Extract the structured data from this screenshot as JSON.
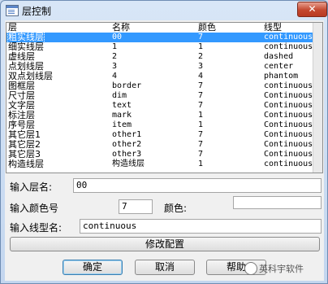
{
  "window": {
    "title": "层控制",
    "close_glyph": "✕"
  },
  "list": {
    "headers": [
      "层",
      "名称",
      "颜色",
      "线型"
    ],
    "rows": [
      {
        "layer": "粗实线层",
        "name": "00",
        "color": "7",
        "linetype": "continuous",
        "selected": true
      },
      {
        "layer": "细实线层",
        "name": "1",
        "color": "1",
        "linetype": "continuous"
      },
      {
        "layer": "虚线层",
        "name": "2",
        "color": "2",
        "linetype": "dashed"
      },
      {
        "layer": "点划线层",
        "name": "3",
        "color": "3",
        "linetype": "center"
      },
      {
        "layer": "双点划线层",
        "name": "4",
        "color": "4",
        "linetype": "phantom"
      },
      {
        "layer": "图框层",
        "name": "border",
        "color": "7",
        "linetype": "continuous"
      },
      {
        "layer": "尺寸层",
        "name": "dim",
        "color": "7",
        "linetype": "Continuous"
      },
      {
        "layer": "文字层",
        "name": "text",
        "color": "7",
        "linetype": "Continuous"
      },
      {
        "layer": "标注层",
        "name": "mark",
        "color": "1",
        "linetype": "Continuous"
      },
      {
        "layer": "序号层",
        "name": "item",
        "color": "1",
        "linetype": "Continuous"
      },
      {
        "layer": "其它层1",
        "name": "other1",
        "color": "7",
        "linetype": "Continuous"
      },
      {
        "layer": "其它层2",
        "name": "other2",
        "color": "7",
        "linetype": "Continuous"
      },
      {
        "layer": "其它层3",
        "name": "other3",
        "color": "7",
        "linetype": "Continuous"
      },
      {
        "layer": "构造线层",
        "name": "构造线层",
        "color": "1",
        "linetype": "continuous"
      }
    ]
  },
  "form": {
    "layer_name_label": "输入层名:",
    "layer_name_value": "00",
    "color_no_label": "输入颜色号",
    "color_no_value": "7",
    "color_label": "颜色:",
    "linetype_label": "输入线型名:",
    "linetype_value": "continuous"
  },
  "buttons": {
    "modify": "修改配置",
    "ok": "确定",
    "cancel": "取消",
    "help": "帮助"
  },
  "watermark": "英科宇软件"
}
